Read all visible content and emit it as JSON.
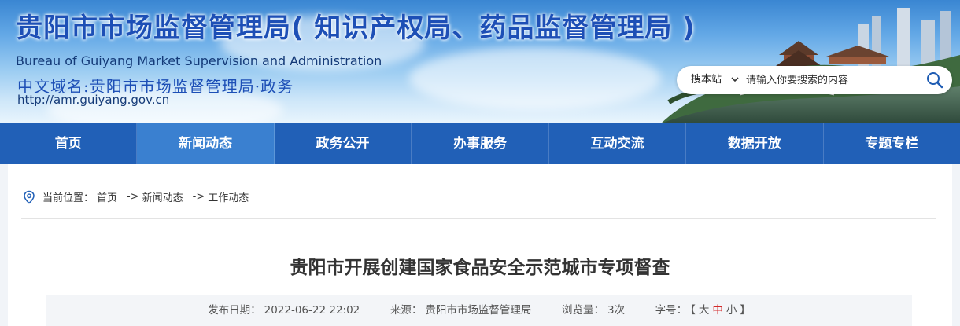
{
  "header": {
    "title": "贵阳市市场监督管理局( 知识产权局、药品监督管理局 )",
    "title_en": "Bureau of Guiyang Market Supervision and Administration",
    "domain_cn": "中文域名:贵阳市市场监督管理局·政务",
    "url": "http://amr.guiyang.gov.cn"
  },
  "search": {
    "site_label": "搜本站",
    "placeholder": "请输入你要搜索的内容"
  },
  "nav": {
    "items": [
      "首页",
      "新闻动态",
      "政务公开",
      "办事服务",
      "互动交流",
      "数据开放",
      "专题专栏"
    ],
    "active": "新闻动态"
  },
  "breadcrumb": {
    "prefix": "当前位置：",
    "items": [
      "首页",
      "新闻动态",
      "工作动态"
    ],
    "separator": "->"
  },
  "article": {
    "title": "贵阳市开展创建国家食品安全示范城市专项督查",
    "publish_label": "发布日期：",
    "publish_date": "2022-06-22 22:02",
    "source_label": "来源：",
    "source": "贵阳市市场监督管理局",
    "views_label": "浏览量：",
    "views": "3次",
    "font_label": "字号：",
    "font_open": "【",
    "font_large": "大",
    "font_medium": "中",
    "font_small": "小",
    "font_close": "】"
  },
  "colors": {
    "nav_bg": "#2160b7",
    "nav_active": "#3a80d0",
    "title_blue": "#1d4fb6",
    "font_mid_red": "#d32b2b"
  }
}
